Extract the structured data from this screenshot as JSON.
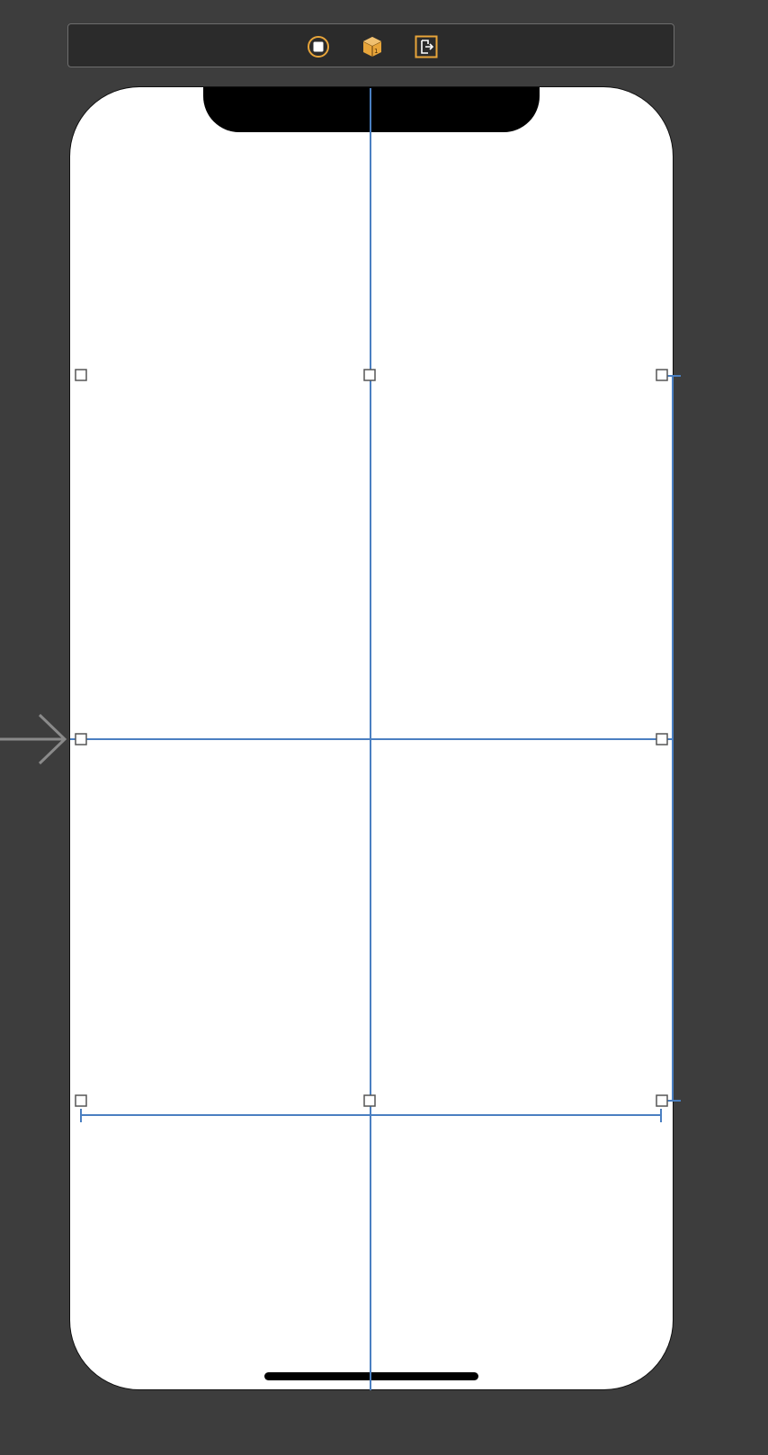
{
  "colors": {
    "background": "#3d3d3d",
    "dock_background": "#2b2b2b",
    "accent_orange": "#e8a53a",
    "device_screen": "#ffffff",
    "device_hardware": "#000000",
    "guide_blue": "#4a7fc1",
    "handle_border": "#555555",
    "entry_arrow": "#8a8a8a"
  },
  "scene_dock": {
    "icons": [
      {
        "name": "view-controller-icon"
      },
      {
        "name": "first-responder-icon"
      },
      {
        "name": "exit-icon"
      }
    ]
  },
  "device": {
    "model": "iphone-notch"
  },
  "selection": {
    "handles": 8
  }
}
